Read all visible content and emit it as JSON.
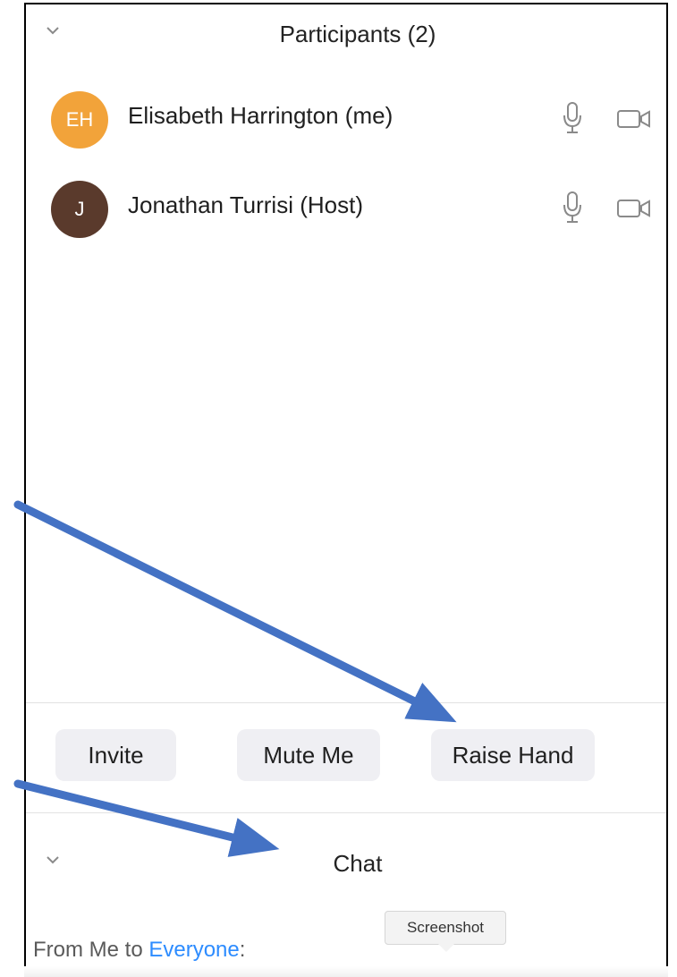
{
  "participants_panel": {
    "title": "Participants (2)",
    "participants": [
      {
        "initials": "EH",
        "name": "Elisabeth Harrington (me)",
        "avatar_color": "#f2a33a"
      },
      {
        "initials": "J",
        "name": "Jonathan Turrisi (Host)",
        "avatar_color": "#5a3a2c"
      }
    ],
    "mic_icon": "microphone-icon",
    "camera_icon": "video-camera-icon"
  },
  "actions": {
    "invite_label": "Invite",
    "mute_label": "Mute Me",
    "raise_hand_label": "Raise Hand"
  },
  "chat_panel": {
    "title": "Chat",
    "from_prefix": "From Me to ",
    "recipient": "Everyone",
    "from_suffix": ":"
  },
  "tooltip": {
    "label": "Screenshot"
  },
  "annotations": {
    "arrow_color": "#4472c4"
  },
  "colors": {
    "link": "#2d8cff",
    "button_bg": "#efeff3",
    "border": "#000000"
  }
}
